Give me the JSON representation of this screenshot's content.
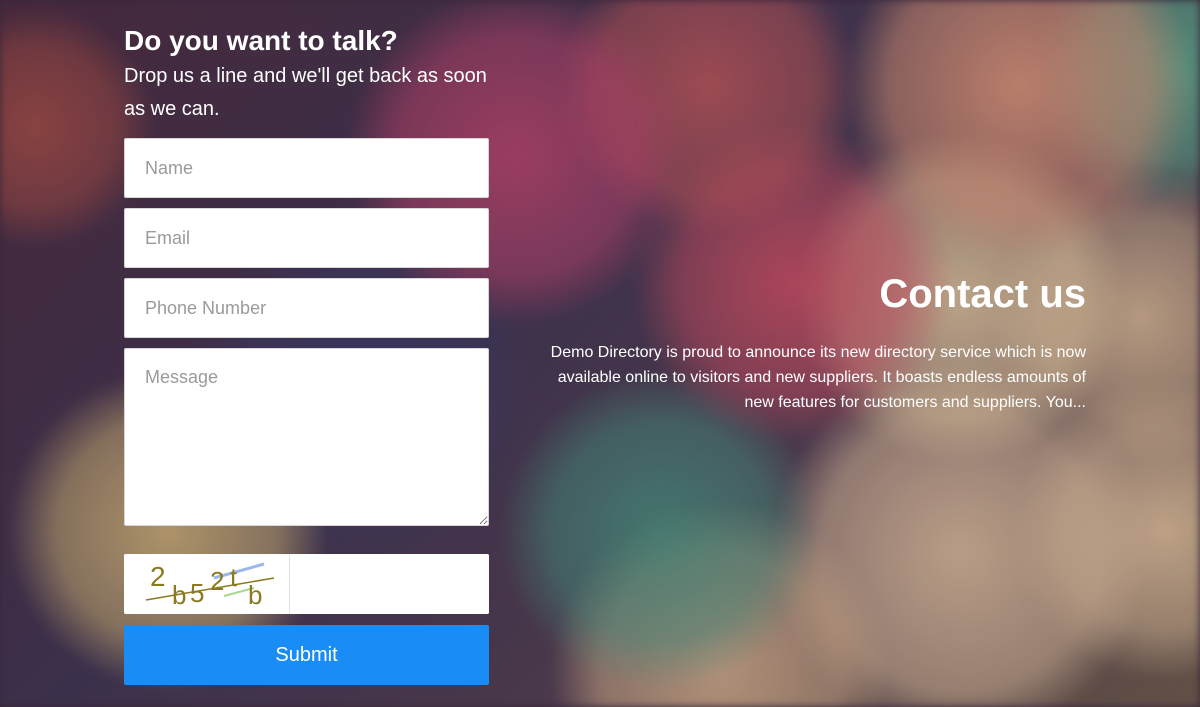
{
  "form": {
    "title": "Do you want to talk?",
    "subtitle": "Drop us a line and we'll get back as soon as we can.",
    "name_placeholder": "Name",
    "email_placeholder": "Email",
    "phone_placeholder": "Phone Number",
    "message_placeholder": "Message",
    "captcha_text": "2b52tb",
    "captcha_input_value": "",
    "submit_label": "Submit"
  },
  "contact": {
    "title": "Contact us",
    "description": "Demo Directory is proud to announce its new directory service which is now available online to visitors and new suppliers. It boasts endless amounts of new features for customers and suppliers. You..."
  },
  "colors": {
    "submit_button": "#1a8cf5",
    "captcha_text": "#8a7a20"
  }
}
